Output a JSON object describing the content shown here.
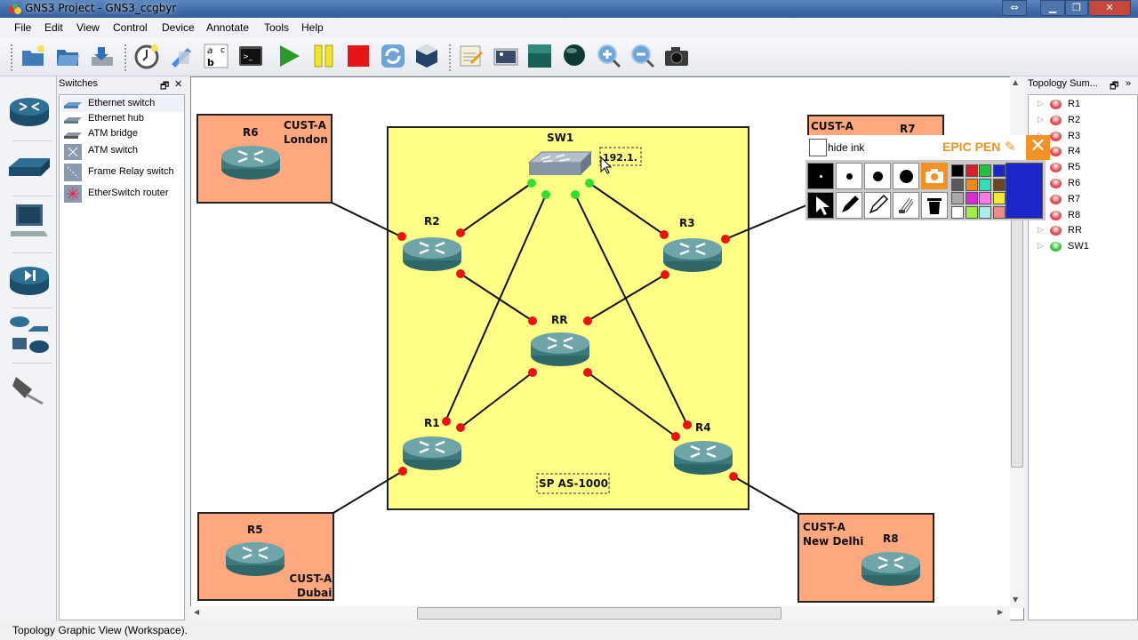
{
  "window": {
    "title": "GNS3 Project - GNS3_ccgbyr",
    "controls": [
      "restore-alt",
      "minimize",
      "maximize",
      "close"
    ]
  },
  "menu": [
    "File",
    "Edit",
    "View",
    "Control",
    "Device",
    "Annotate",
    "Tools",
    "Help"
  ],
  "toolbar": {
    "buttons": [
      "new-project-icon",
      "open-project-icon",
      "save-project-icon",
      "snapshot-icon",
      "import-export-icon",
      "show-labels-icon",
      "console-icon",
      "start-icon",
      "suspend-icon",
      "stop-icon",
      "reload-icon",
      "virtualbox-icon",
      "add-note-icon",
      "insert-picture-icon",
      "draw-rectangle-icon",
      "draw-ellipse-icon",
      "zoom-in-icon",
      "zoom-out-icon",
      "screenshot-icon"
    ]
  },
  "device_bar": [
    "routers",
    "switches",
    "end-devices",
    "security-devices",
    "all-devices",
    "cloud-connector"
  ],
  "switches_panel": {
    "title": "Switches",
    "items": [
      "Ethernet switch",
      "Ethernet hub",
      "ATM bridge",
      "ATM switch",
      "Frame Relay switch",
      "EtherSwitch router"
    ]
  },
  "topology_summary": {
    "title": "Topology Sum...",
    "items": [
      {
        "name": "R1",
        "status": "stopped"
      },
      {
        "name": "R2",
        "status": "stopped"
      },
      {
        "name": "R3",
        "status": "stopped"
      },
      {
        "name": "R4",
        "status": "stopped"
      },
      {
        "name": "R5",
        "status": "stopped"
      },
      {
        "name": "R6",
        "status": "stopped"
      },
      {
        "name": "R7",
        "status": "stopped"
      },
      {
        "name": "R8",
        "status": "stopped"
      },
      {
        "name": "RR",
        "status": "stopped"
      },
      {
        "name": "SW1",
        "status": "started"
      }
    ]
  },
  "colors": {
    "stopped": "#e8454f",
    "started": "#3fbf3f",
    "sp_area": "#ffff88",
    "cust_area": "#ffa880",
    "epic_orange": "#f39222",
    "selected_color": "#1c25c8"
  },
  "topology": {
    "sp_label": "SP AS-1000",
    "note_editing": "192.1.",
    "nodes": {
      "SW1": "SW1",
      "R1": "R1",
      "R2": "R2",
      "R3": "R3",
      "R4": "R4",
      "RR": "RR",
      "R5": "R5",
      "R6": "R6",
      "R7": "R7",
      "R8": "R8"
    },
    "customers": {
      "london": [
        "CUST-A",
        "London"
      ],
      "dubai": [
        "CUST-A",
        "Dubai"
      ],
      "newdelhi": [
        "CUST-A",
        "New Delhi"
      ],
      "r7site": [
        "CUST-A"
      ]
    }
  },
  "epic_pen": {
    "hide_ink_label": "hide ink",
    "brand": "EPIC PEN",
    "palette": [
      "#000000",
      "#d8202a",
      "#23c23b",
      "#1c25c8",
      "#5a5a5a",
      "#f08a10",
      "#2de0b8",
      "#6b4a22",
      "#a8a8a8",
      "#d92ad9",
      "#ff7ae8",
      "#f2ec28",
      "#ffffff",
      "#9ef040",
      "#a8f0ec",
      "#f08a8a"
    ]
  },
  "status": "Topology Graphic View (Workspace)."
}
